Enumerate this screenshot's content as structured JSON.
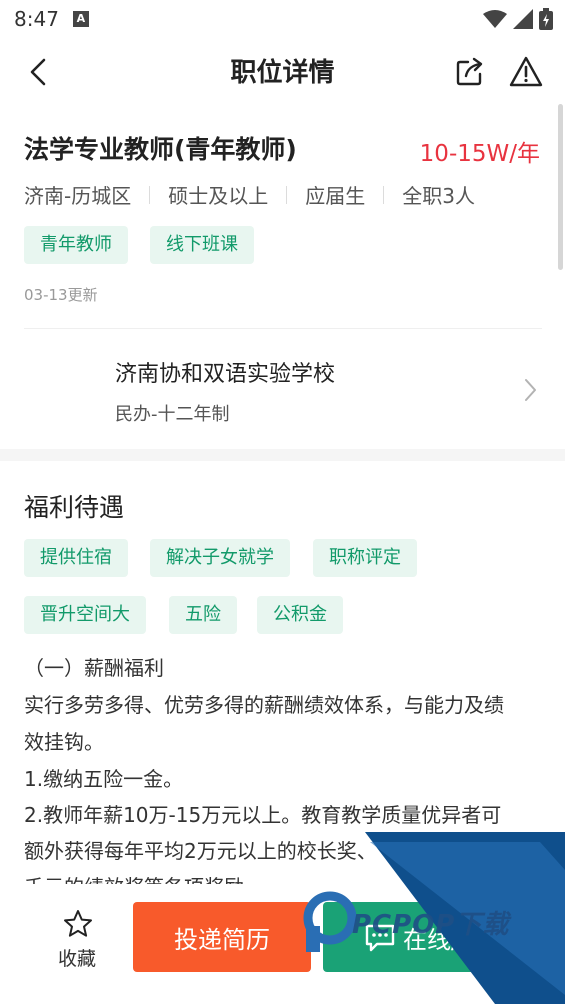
{
  "status": {
    "time": "8:47",
    "notification_letter": "A"
  },
  "nav": {
    "title": "职位详情"
  },
  "job": {
    "title": "法学专业教师(青年教师)",
    "salary": "10-15W/年",
    "meta": [
      "济南-历城区",
      "硕士及以上",
      "应届生",
      "全职3人"
    ],
    "tags": [
      "青年教师",
      "线下班课"
    ],
    "update_time": "03-13更新"
  },
  "school": {
    "name": "济南协和双语实验学校",
    "type": "民办-十二年制"
  },
  "welfare": {
    "title": "福利待遇",
    "tags": [
      "提供住宿",
      "解决子女就学",
      "职称评定",
      "晋升空间大",
      "五险",
      "公积金"
    ],
    "lines": [
      "（一）薪酬福利",
      "实行多劳多得、优劳多得的薪酬绩效体系，与能力及绩",
      "效挂钩。",
      "1.缴纳五险一金。",
      "2.教师年薪10万-15万元以上。教育教学质量优异者可",
      "额外获得每年平均2万元以上的校长奖、",
      "千元的绩效奖等各项奖励。"
    ]
  },
  "bottom": {
    "favorite_label": "收藏",
    "apply_label": "投递简历",
    "chat_label": "在线/"
  },
  "watermark": {
    "text": "PCPOP下载"
  },
  "colors": {
    "accent_green": "#129a6a",
    "tag_bg": "#e8f6f0",
    "salary_red": "#e8333f",
    "apply_orange": "#f85a2b",
    "chat_green": "#1aa276"
  }
}
